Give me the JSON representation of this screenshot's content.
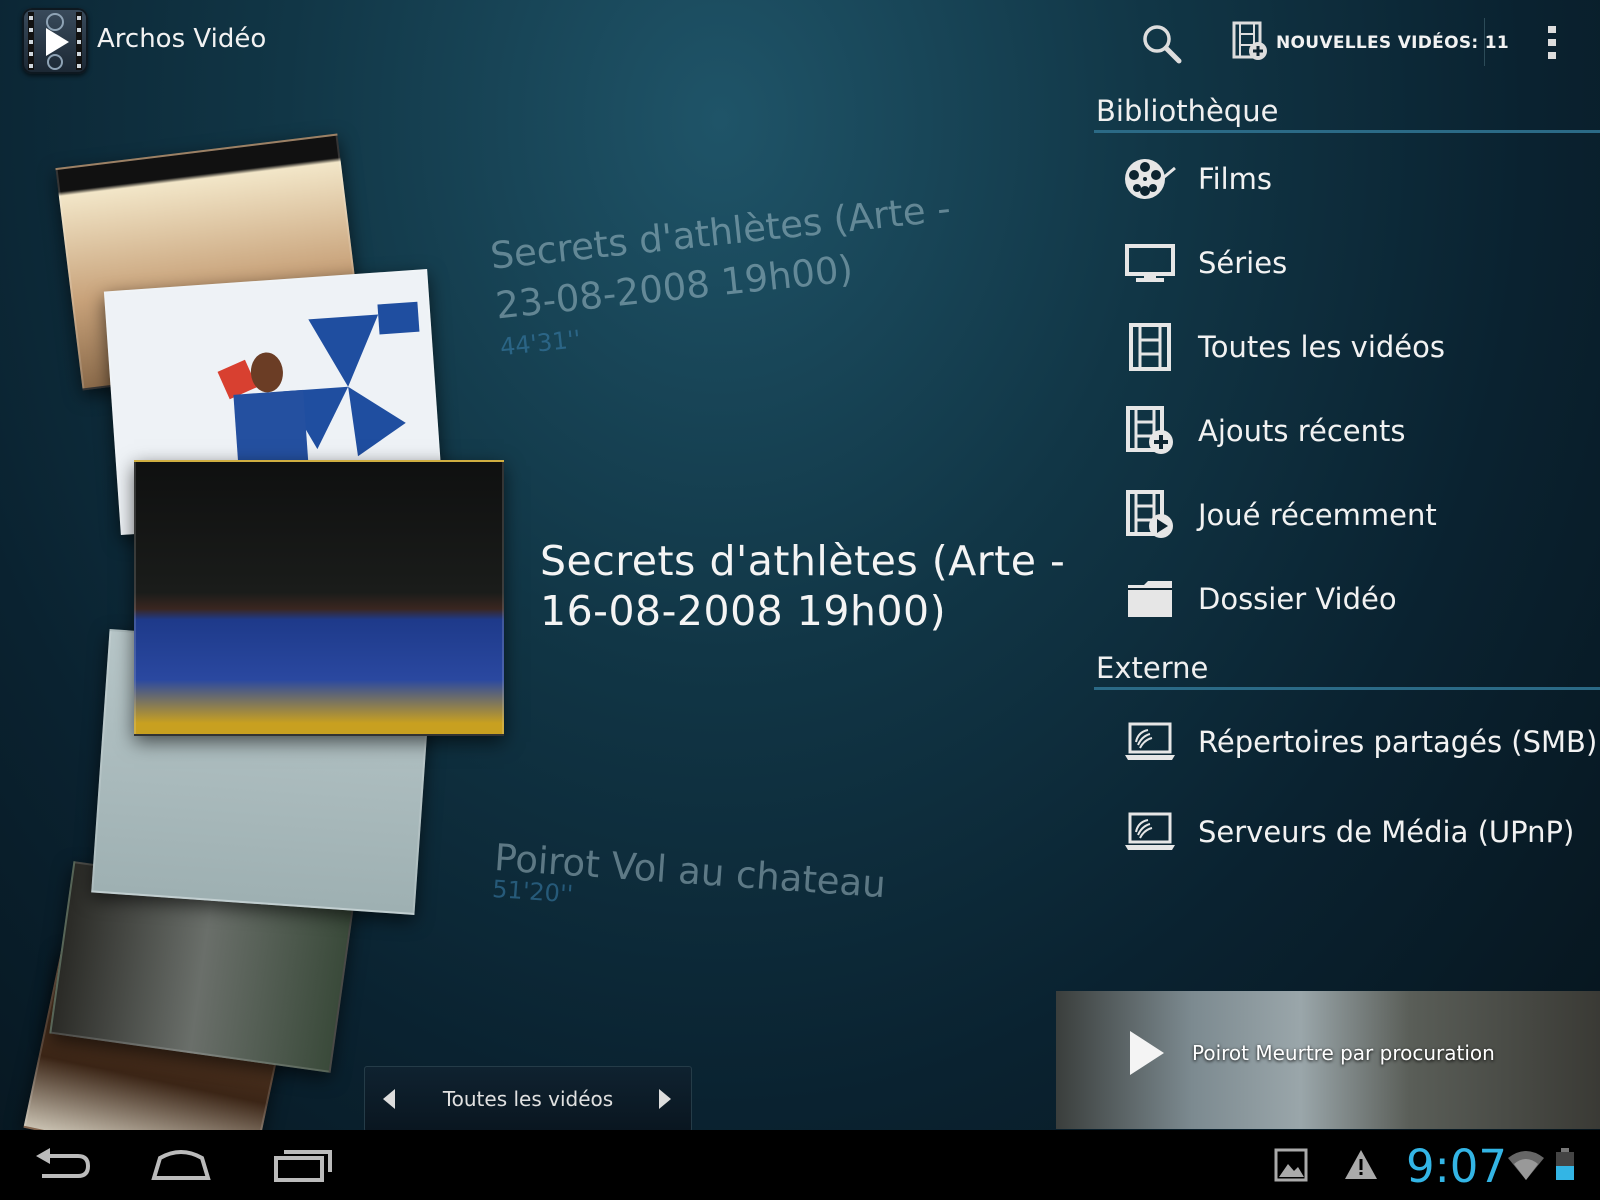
{
  "app": {
    "title": "Archos Vidéo",
    "icon": "archos-video-icon"
  },
  "actionbar": {
    "search_icon": "search-icon",
    "new_videos_label": "NOUVELLES VIDÉOS: 11",
    "overflow_icon": "overflow-menu-icon"
  },
  "carousel": {
    "prev": {
      "title_line1": "Secrets d'athlètes (Arte -",
      "title_line2": "23-08-2008 19h00)",
      "duration": "44'31''"
    },
    "current": {
      "title_line1": "Secrets d'athlètes (Arte -",
      "title_line2": "16-08-2008 19h00)"
    },
    "next": {
      "title": "Poirot Vol au chateau",
      "duration": "51'20''"
    }
  },
  "library": {
    "header": "Bibliothèque",
    "items": [
      {
        "label": "Films",
        "icon": "film-reel-icon"
      },
      {
        "label": "Séries",
        "icon": "tv-monitor-icon"
      },
      {
        "label": "Toutes les vidéos",
        "icon": "film-strip-icon"
      },
      {
        "label": "Ajouts récents",
        "icon": "film-add-icon"
      },
      {
        "label": "Joué récemment",
        "icon": "film-play-icon"
      },
      {
        "label": "Dossier Vidéo",
        "icon": "folder-icon"
      }
    ]
  },
  "external": {
    "header": "Externe",
    "items": [
      {
        "label": "Répertoires partagés (SMB)",
        "icon": "laptop-network-icon"
      },
      {
        "label": "Serveurs de Média (UPnP)",
        "icon": "laptop-network-icon"
      }
    ]
  },
  "now_playing": {
    "title": "Poirot Meurtre par procuration"
  },
  "filter": {
    "label": "Toutes les vidéos"
  },
  "statusbar": {
    "time": "9:07"
  },
  "colors": {
    "accent": "#33b5e5",
    "divider": "#2b6a86"
  }
}
